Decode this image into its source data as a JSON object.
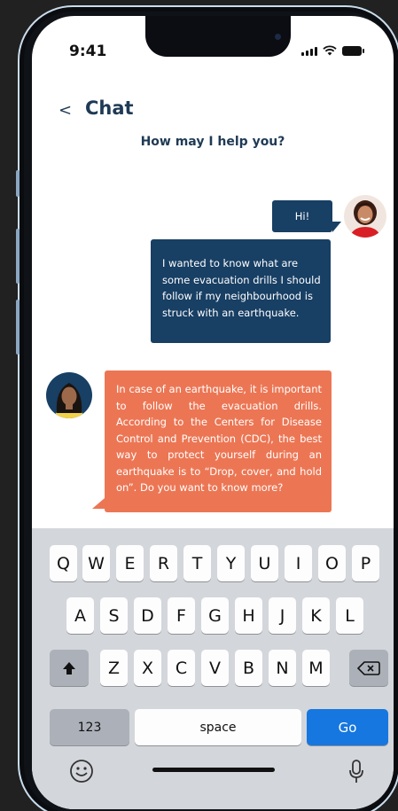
{
  "status_bar": {
    "time": "9:41"
  },
  "header": {
    "back_label": "<",
    "title": "Chat",
    "subtitle": "How may I help you?"
  },
  "messages": [
    {
      "sender": "user",
      "text": "Hi!"
    },
    {
      "sender": "user",
      "text": "I wanted to know what are some evacuation drills I should follow if my neighbourhood is struck with an earthquake."
    },
    {
      "sender": "bot",
      "text": "In case of an earthquake, it is important to follow the evacuation drills. According to the Centers for Disease Control and Prevention (CDC), the best way to protect yourself during an earthquake is to “Drop, cover, and hold on”. Do you want to know more?"
    }
  ],
  "keyboard": {
    "row1": [
      "Q",
      "W",
      "E",
      "R",
      "T",
      "Y",
      "U",
      "I",
      "O",
      "P"
    ],
    "row2": [
      "A",
      "S",
      "D",
      "F",
      "G",
      "H",
      "J",
      "K",
      "L"
    ],
    "row3": [
      "Z",
      "X",
      "C",
      "V",
      "B",
      "N",
      "M"
    ],
    "numbers_label": "123",
    "space_label": "space",
    "go_label": "Go"
  },
  "colors": {
    "user_bubble": "#183f64",
    "bot_bubble": "#ec7654",
    "go_key": "#1677e0",
    "title": "#1f3a55"
  }
}
